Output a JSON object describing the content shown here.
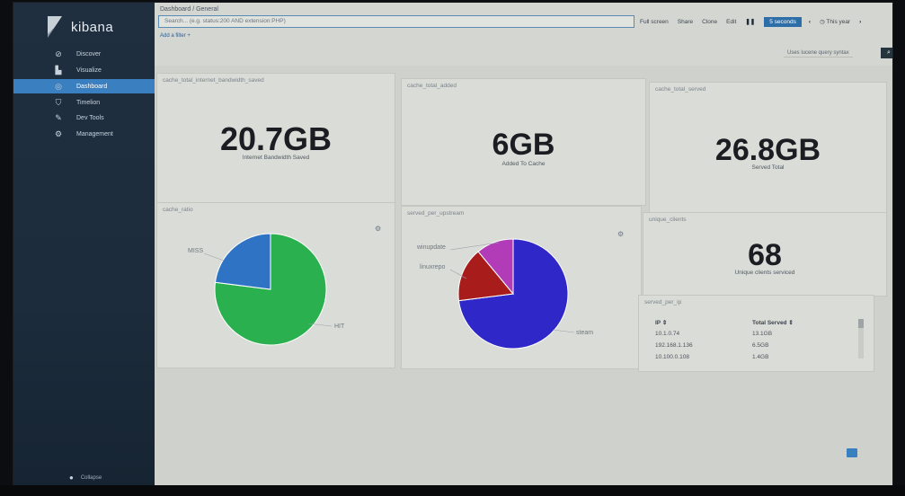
{
  "app": {
    "name": "kibana"
  },
  "sidebar": {
    "items": [
      {
        "label": "Discover",
        "icon": "compass-icon",
        "glyph": "⊘"
      },
      {
        "label": "Visualize",
        "icon": "bar-chart-icon",
        "glyph": "▙"
      },
      {
        "label": "Dashboard",
        "icon": "dashboard-icon",
        "glyph": "◎",
        "active": true
      },
      {
        "label": "Timelion",
        "icon": "timelion-icon",
        "glyph": "⛉"
      },
      {
        "label": "Dev Tools",
        "icon": "wrench-icon",
        "glyph": "✎"
      },
      {
        "label": "Management",
        "icon": "gear-icon",
        "glyph": "⚙"
      }
    ],
    "collapse_label": "Collapse",
    "collapse_glyph": "●"
  },
  "topbar": {
    "breadcrumb": "Dashboard / General",
    "search_placeholder": "Search... (e.g. status:200 AND extension:PHP)",
    "menu": {
      "full_screen": "Full screen",
      "share": "Share",
      "clone": "Clone",
      "edit": "Edit",
      "pause": "❚❚",
      "interval": "5 seconds",
      "prev": "‹",
      "time_range": "◷ This year",
      "next": "›"
    },
    "add_filter": "Add a filter +",
    "query_syntax": "Uses lucene query syntax",
    "search_button_glyph": "⌕"
  },
  "panels": {
    "bandwidth": {
      "title": "cache_total_internet_bandwidth_saved",
      "value": "20.7GB",
      "label": "Internet Bandwidth Saved"
    },
    "added": {
      "title": "cache_total_added",
      "value": "6GB",
      "label": "Added To Cache"
    },
    "served": {
      "title": "cache_total_served",
      "value": "26.8GB",
      "label": "Served Total"
    },
    "ratio": {
      "title": "cache_ratio",
      "gear": "⚙"
    },
    "upstream": {
      "title": "served_per_upstream",
      "gear": "⚙"
    },
    "clients": {
      "title": "unique_clients",
      "value": "68",
      "label": "Unique clients serviced"
    },
    "per_ip": {
      "title": "served_per_ip",
      "columns": [
        "IP ⇕",
        "Total Served ⇕"
      ],
      "rows": [
        [
          "10.1.0.74",
          "13.1GB"
        ],
        [
          "192.168.1.136",
          "6.5GB"
        ],
        [
          "10.100.0.108",
          "1.4GB"
        ]
      ]
    }
  },
  "chart_data": [
    {
      "type": "pie",
      "categories": [
        "HIT",
        "MISS"
      ],
      "values": [
        77,
        23
      ],
      "colors": [
        "#2bb04f",
        "#2f74c4"
      ]
    },
    {
      "type": "pie",
      "categories": [
        "steam",
        "linuxrepo",
        "winupdate"
      ],
      "values": [
        73,
        16,
        11
      ],
      "colors": [
        "#2f27c8",
        "#a81c1c",
        "#b23bb8"
      ]
    }
  ]
}
